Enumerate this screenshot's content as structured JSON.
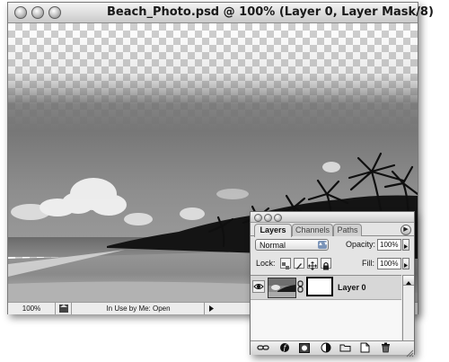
{
  "document": {
    "title": "Beach_Photo.psd @ 100% (Layer 0, Layer Mask/8)",
    "zoom": "100%",
    "status": "In Use by Me: Open"
  },
  "layers_palette": {
    "tabs": [
      "Layers",
      "Channels",
      "Paths"
    ],
    "active_tab": "Layers",
    "blend_mode": "Normal",
    "opacity_label": "Opacity:",
    "opacity_value": "100%",
    "lock_label": "Lock:",
    "fill_label": "Fill:",
    "fill_value": "100%",
    "layers": [
      {
        "name": "Layer 0",
        "visible": true,
        "has_mask": true,
        "linked": true
      }
    ],
    "bottom_buttons": [
      "link-layers-icon",
      "layer-style-icon",
      "add-mask-icon",
      "adjustment-layer-icon",
      "new-group-icon",
      "new-layer-icon",
      "trash-icon"
    ]
  },
  "colors": {
    "checker_light": "#ffffff",
    "checker_dark": "#cfcfcf",
    "window_chrome": "#e8e8e8",
    "palette_bg": "#e4e4e4",
    "selected_layer_row": "#d7d7d7"
  }
}
